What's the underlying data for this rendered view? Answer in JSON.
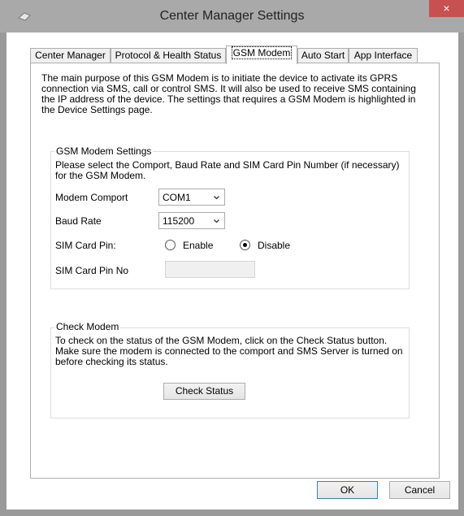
{
  "window": {
    "title": "Center Manager Settings",
    "close_glyph": "×"
  },
  "tabs": [
    {
      "label": "Center Manager"
    },
    {
      "label": "Protocol & Health Status"
    },
    {
      "label": "GSM Modem"
    },
    {
      "label": "Auto Start"
    },
    {
      "label": "App Interface"
    }
  ],
  "intro": "The main purpose of this GSM Modem is to initiate the device to activate its GPRS connection via SMS, call or control SMS. It will also be used to receive SMS containing the IP address of the device. The settings that requires a GSM Modem is highlighted in the Device Settings page.",
  "modem_settings": {
    "title": "GSM Modem Settings",
    "description": "Please select the Comport, Baud Rate and SIM Card Pin Number (if necessary) for the GSM Modem.",
    "comport_label": "Modem Comport",
    "comport_value": "COM1",
    "baud_label": "Baud Rate",
    "baud_value": "115200",
    "sim_pin_label": "SIM Card Pin:",
    "enable_label": "Enable",
    "disable_label": "Disable",
    "sim_pin_selected": "Disable",
    "sim_pin_no_label": "SIM Card Pin No",
    "sim_pin_no_value": ""
  },
  "check_modem": {
    "title": "Check Modem",
    "description": "To check on the status of the GSM Modem, click on the Check Status button. Make sure the modem is connected to the comport and SMS Server is turned on before checking its status.",
    "button_label": "Check Status"
  },
  "footer": {
    "ok_label": "OK",
    "cancel_label": "Cancel"
  }
}
